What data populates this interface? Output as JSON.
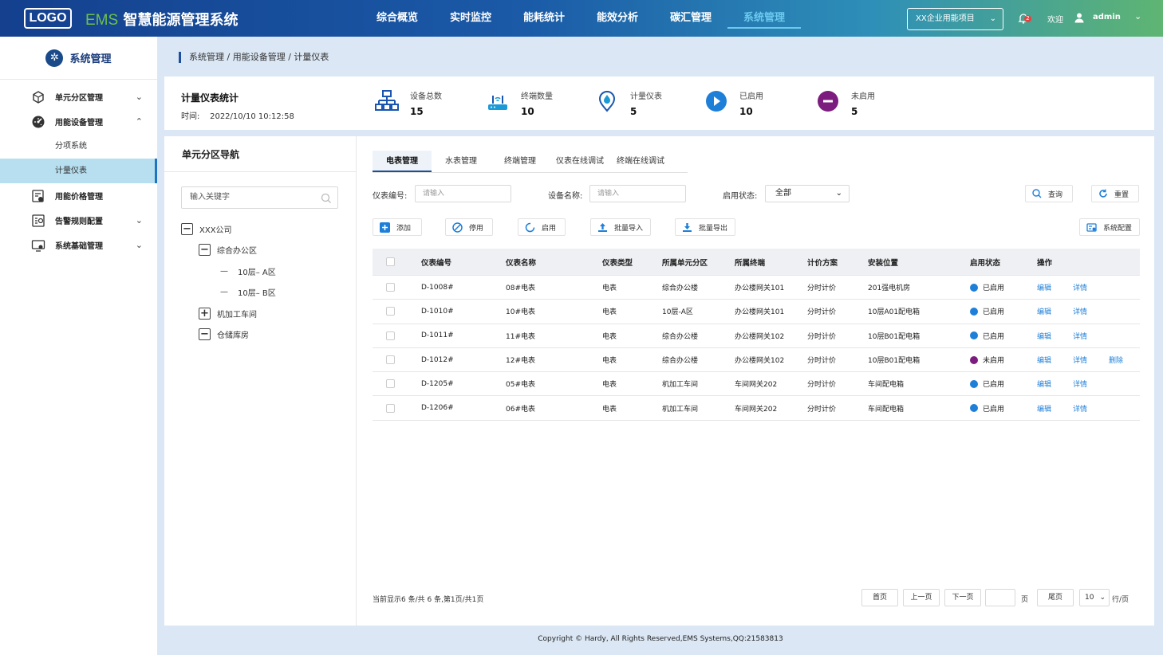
{
  "header": {
    "logo": "LOGO",
    "brand_prefix": "EMS",
    "title": "智慧能源管理系统",
    "nav": [
      "综合概览",
      "实时监控",
      "能耗统计",
      "能效分析",
      "碳汇管理",
      "系统管理"
    ],
    "active_nav": "系统管理",
    "project": "XX企业用能项目",
    "notification_count": "2",
    "welcome": "欢迎",
    "username": "admin"
  },
  "sidebar": {
    "title": "系统管理",
    "items": [
      {
        "label": "单元分区管理",
        "icon": "cube-icon",
        "expanded": false
      },
      {
        "label": "用能设备管理",
        "icon": "gauge-icon",
        "expanded": true,
        "children": [
          "分项系统",
          "计量仪表"
        ]
      },
      {
        "label": "用能价格管理",
        "icon": "price-sheet-icon"
      },
      {
        "label": "告警规则配置",
        "icon": "alarm-rule-icon",
        "expanded": false
      },
      {
        "label": "系统基础管理",
        "icon": "monitor-settings-icon",
        "expanded": false
      }
    ],
    "active_child": "计量仪表"
  },
  "breadcrumb": "系统管理 / 用能设备管理 / 计量仪表",
  "stats": {
    "title": "计量仪表统计",
    "time_label": "时间:",
    "time_value": "2022/10/10 10:12:58",
    "items": [
      {
        "label": "设备总数",
        "value": "15",
        "icon": "network-icon",
        "color": "#1a56b0"
      },
      {
        "label": "终端数量",
        "value": "10",
        "icon": "router-icon",
        "color": "#1a9ad6"
      },
      {
        "label": "计量仪表",
        "value": "5",
        "icon": "meter-drop-icon",
        "color": "#1a9ad6"
      },
      {
        "label": "已启用",
        "value": "10",
        "icon": "play-icon",
        "color": "#1e7fd8"
      },
      {
        "label": "未启用",
        "value": "5",
        "icon": "minus-icon",
        "color": "#7b1c7e"
      }
    ]
  },
  "tree": {
    "title": "单元分区导航",
    "search_placeholder": "输入关键字",
    "nodes": [
      "XXX公司",
      "综合办公区",
      "10层– A区",
      "10层– B区",
      "机加工车间",
      "仓储库房"
    ]
  },
  "tabs": [
    "电表管理",
    "水表管理",
    "终端管理",
    "仪表在线调试",
    "终端在线调试"
  ],
  "filters": {
    "meter_no_label": "仪表编号:",
    "meter_no_placeholder": "请输入",
    "device_name_label": "设备名称:",
    "device_name_placeholder": "请输入",
    "status_label": "启用状态:",
    "status_value": "全部",
    "query": "查询",
    "reset": "重置"
  },
  "actions": {
    "add": "添加",
    "disable": "停用",
    "enable": "启用",
    "import": "批量导入",
    "export": "批量导出",
    "config": "系统配置"
  },
  "table": {
    "columns": [
      "仪表编号",
      "仪表名称",
      "仪表类型",
      "所属单元分区",
      "所属终端",
      "计价方案",
      "安装位置",
      "启用状态",
      "操作"
    ],
    "rows": [
      {
        "no": "D-1008#",
        "name": "08#电表",
        "type": "电表",
        "zone": "综合办公楼",
        "terminal": "办公楼网关101",
        "plan": "分时计价",
        "location": "201强电机房",
        "status": "已启用",
        "enabled": true,
        "ops": [
          "编辑",
          "详情"
        ]
      },
      {
        "no": "D-1010#",
        "name": "10#电表",
        "type": "电表",
        "zone": "10层-A区",
        "terminal": "办公楼网关101",
        "plan": "分时计价",
        "location": "10层A01配电箱",
        "status": "已启用",
        "enabled": true,
        "ops": [
          "编辑",
          "详情"
        ]
      },
      {
        "no": "D-1011#",
        "name": "11#电表",
        "type": "电表",
        "zone": "综合办公楼",
        "terminal": "办公楼网关102",
        "plan": "分时计价",
        "location": "10层B01配电箱",
        "status": "已启用",
        "enabled": true,
        "ops": [
          "编辑",
          "详情"
        ]
      },
      {
        "no": "D-1012#",
        "name": "12#电表",
        "type": "电表",
        "zone": "综合办公楼",
        "terminal": "办公楼网关102",
        "plan": "分时计价",
        "location": "10层B01配电箱",
        "status": "未启用",
        "enabled": false,
        "ops": [
          "编辑",
          "详情",
          "删除"
        ]
      },
      {
        "no": "D-1205#",
        "name": "05#电表",
        "type": "电表",
        "zone": "机加工车间",
        "terminal": "车间网关202",
        "plan": "分时计价",
        "location": "车间配电箱",
        "status": "已启用",
        "enabled": true,
        "ops": [
          "编辑",
          "详情"
        ]
      },
      {
        "no": "D-1206#",
        "name": "06#电表",
        "type": "电表",
        "zone": "机加工车间",
        "terminal": "车间网关202",
        "plan": "分时计价",
        "location": "车间配电箱",
        "status": "已启用",
        "enabled": true,
        "ops": [
          "编辑",
          "详情"
        ]
      }
    ]
  },
  "pagination": {
    "info": "当前显示6 条/共 6 条,第1页/共1页",
    "first": "首页",
    "prev": "上一页",
    "next": "下一页",
    "page_unit": "页",
    "last": "尾页",
    "page_size": "10",
    "size_unit": "行/页"
  },
  "footer": "Copyright © Hardy, All Rights Reserved,EMS Systems,QQ:21583813",
  "colors": {
    "primary": "#1a4a8a",
    "accent": "#1e7fd8",
    "active_nav": "#6cc9ee",
    "disabled": "#7b1c7e"
  }
}
